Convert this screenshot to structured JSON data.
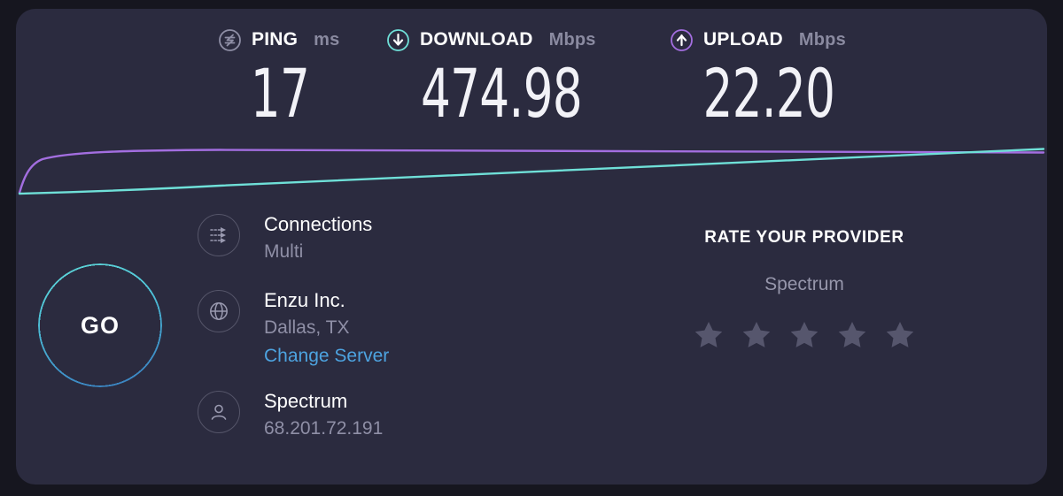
{
  "metrics": [
    {
      "icon": "ping-icon",
      "title": "PING",
      "unit": "ms",
      "value": "17",
      "color": "#8f8fa6"
    },
    {
      "icon": "download-arrow-icon",
      "title": "DOWNLOAD",
      "unit": "Mbps",
      "value": "474.98",
      "color": "#6fe0d8"
    },
    {
      "icon": "upload-arrow-icon",
      "title": "UPLOAD",
      "unit": "Mbps",
      "value": "22.20",
      "color": "#a36ee0"
    }
  ],
  "graph": {
    "download_color": "#6fe0d8",
    "upload_color": "#a36ee0"
  },
  "go_button": {
    "label": "GO",
    "ring_color_top": "#5fd6d6",
    "ring_color_bottom": "#3a7fbf"
  },
  "connection": {
    "items": [
      {
        "icon": "connections-arrows-icon",
        "primary": "Connections",
        "secondary": "Multi",
        "link": ""
      },
      {
        "icon": "globe-icon",
        "primary": "Enzu Inc.",
        "secondary": "Dallas, TX",
        "link": "Change Server"
      },
      {
        "icon": "person-icon",
        "primary": "Spectrum",
        "secondary": "68.201.72.191",
        "link": ""
      }
    ]
  },
  "rating": {
    "title": "RATE YOUR PROVIDER",
    "provider": "Spectrum",
    "stars_total": 5,
    "stars_filled": 0,
    "star_color": "#56566d"
  },
  "theme": {
    "page_background": "#16161f",
    "card_background": "#2b2b3f",
    "text_primary": "#ffffff",
    "text_secondary": "#8f8fa6",
    "link_color": "#4da3e0"
  }
}
